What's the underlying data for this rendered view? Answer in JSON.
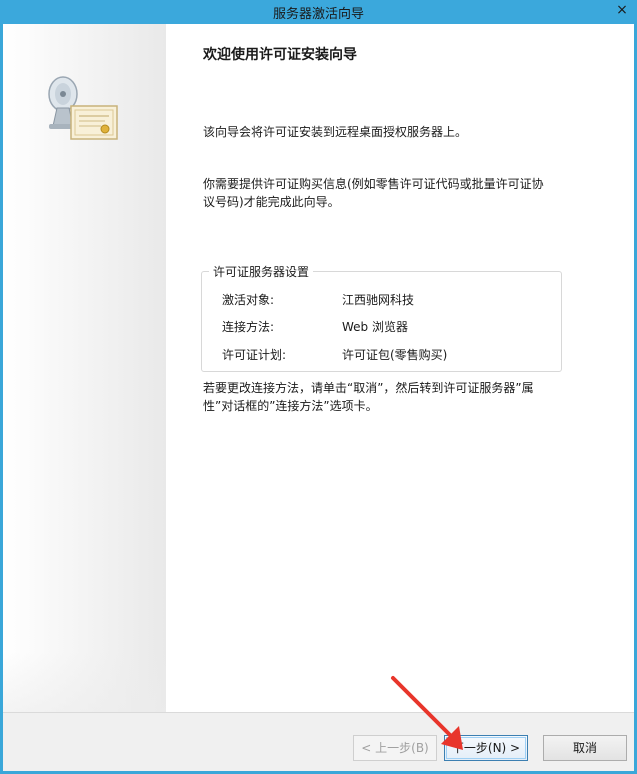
{
  "window": {
    "title": "服务器激活向导",
    "close_glyph": "×"
  },
  "wizard": {
    "heading": "欢迎使用许可证安装向导",
    "intro": "该向导会将许可证安装到远程桌面授权服务器上。",
    "requirement": "你需要提供许可证购买信息(例如零售许可证代码或批量许可证协议号码)才能完成此向导。",
    "group": {
      "title": "许可证服务器设置",
      "rows": [
        {
          "label": "激活对象:",
          "value": "江西驰网科技"
        },
        {
          "label": "连接方法:",
          "value": "Web 浏览器"
        },
        {
          "label": "许可证计划:",
          "value": "许可证包(零售购买)"
        }
      ]
    },
    "note": "若要更改连接方法，请单击“取消”，然后转到许可证服务器”属性”对话框的”连接方法”选项卡。"
  },
  "buttons": {
    "back": "< 上一步(B)",
    "next": "下一步(N) >",
    "cancel": "取消"
  },
  "colors": {
    "titlebar": "#3ba8dc",
    "arrow": "#e8352b"
  }
}
